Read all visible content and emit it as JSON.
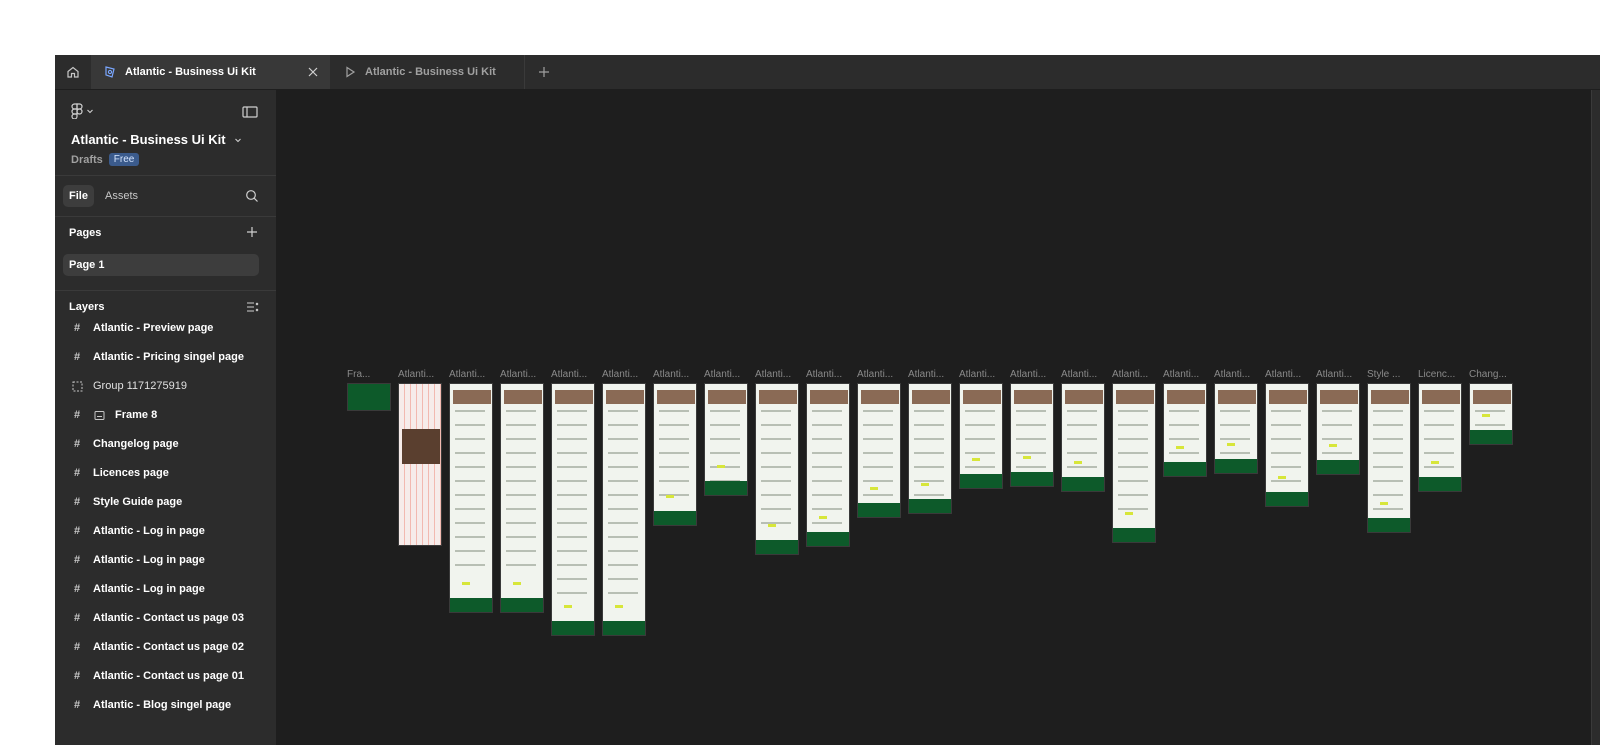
{
  "tabs": {
    "active_label": "Atlantic - Business Ui Kit",
    "prototype_label": "Atlantic - Business Ui Kit"
  },
  "sidebar": {
    "file_title": "Atlantic - Business Ui Kit",
    "location": "Drafts",
    "plan_badge": "Free",
    "tab_file": "File",
    "tab_assets": "Assets",
    "pages_title": "Pages",
    "current_page": "Page 1",
    "layers_title": "Layers",
    "layers": [
      {
        "label": "Atlantic - Preview page",
        "icon": "frame-icon"
      },
      {
        "label": "Atlantic - Pricing singel page",
        "icon": "frame-icon"
      },
      {
        "label": "Group 1171275919",
        "icon": "group-icon"
      },
      {
        "label": "Frame 8",
        "icon": "frame-icon"
      },
      {
        "label": "Changelog page",
        "icon": "frame-icon"
      },
      {
        "label": "Licences page",
        "icon": "frame-icon"
      },
      {
        "label": "Style Guide page",
        "icon": "frame-icon"
      },
      {
        "label": "Atlantic - Log in page",
        "icon": "frame-icon"
      },
      {
        "label": "Atlantic - Log in page",
        "icon": "frame-icon"
      },
      {
        "label": "Atlantic - Log in page",
        "icon": "frame-icon"
      },
      {
        "label": "Atlantic - Contact us page 03",
        "icon": "frame-icon"
      },
      {
        "label": "Atlantic - Contact us page 02",
        "icon": "frame-icon"
      },
      {
        "label": "Atlantic - Contact us page 01",
        "icon": "frame-icon"
      },
      {
        "label": "Atlantic - Blog singel page",
        "icon": "frame-icon"
      }
    ]
  },
  "canvas": {
    "frame_labels": [
      "Fra...",
      "Atlanti...",
      "Atlanti...",
      "Atlanti...",
      "Atlanti...",
      "Atlanti...",
      "Atlanti...",
      "Atlanti...",
      "Atlanti...",
      "Atlanti...",
      "Atlanti...",
      "Atlanti...",
      "Atlanti...",
      "Atlanti...",
      "Atlanti...",
      "Atlanti...",
      "Atlanti...",
      "Atlanti...",
      "Atlanti...",
      "Atlanti...",
      "Style ...",
      "Licenc...",
      "Chang..."
    ]
  },
  "colors": {
    "brand_green": "#0d5a2a",
    "accent_yellow": "#d7e63a",
    "canvas_bg": "#1e1e1e",
    "panel_bg": "#2c2c2c",
    "badge_bg": "#3b5b8c"
  }
}
